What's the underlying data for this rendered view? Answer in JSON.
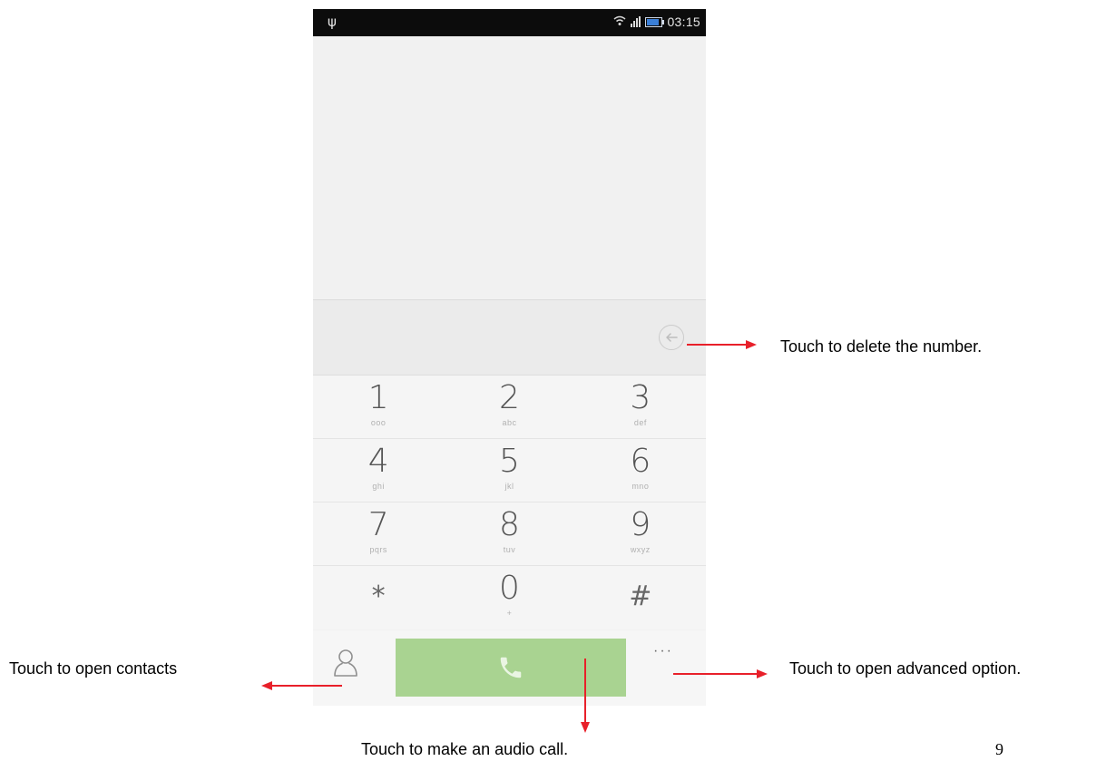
{
  "status_bar": {
    "usb_icon": "usb-icon",
    "time": "03:15"
  },
  "keypad": {
    "rows": [
      [
        {
          "digit": "1",
          "letters": "ooo"
        },
        {
          "digit": "2",
          "letters": "abc"
        },
        {
          "digit": "3",
          "letters": "def"
        }
      ],
      [
        {
          "digit": "4",
          "letters": "ghi"
        },
        {
          "digit": "5",
          "letters": "jkl"
        },
        {
          "digit": "6",
          "letters": "mno"
        }
      ],
      [
        {
          "digit": "7",
          "letters": "pqrs"
        },
        {
          "digit": "8",
          "letters": "tuv"
        },
        {
          "digit": "9",
          "letters": "wxyz"
        }
      ],
      [
        {
          "digit": "*",
          "letters": ""
        },
        {
          "digit": "0",
          "letters": "+"
        },
        {
          "digit": "#",
          "letters": ""
        }
      ]
    ]
  },
  "bottom_bar": {
    "more_label": "···"
  },
  "annotations": {
    "delete_caption": "Touch to delete the number.",
    "contacts_caption": "Touch to open contacts",
    "advanced_caption": "Touch to open advanced option.",
    "call_caption": "Touch to make an audio call."
  },
  "page_number": "9",
  "colors": {
    "arrow": "#e8202a",
    "call_button": "#a9d391",
    "status_bar": "#0c0c0c"
  }
}
